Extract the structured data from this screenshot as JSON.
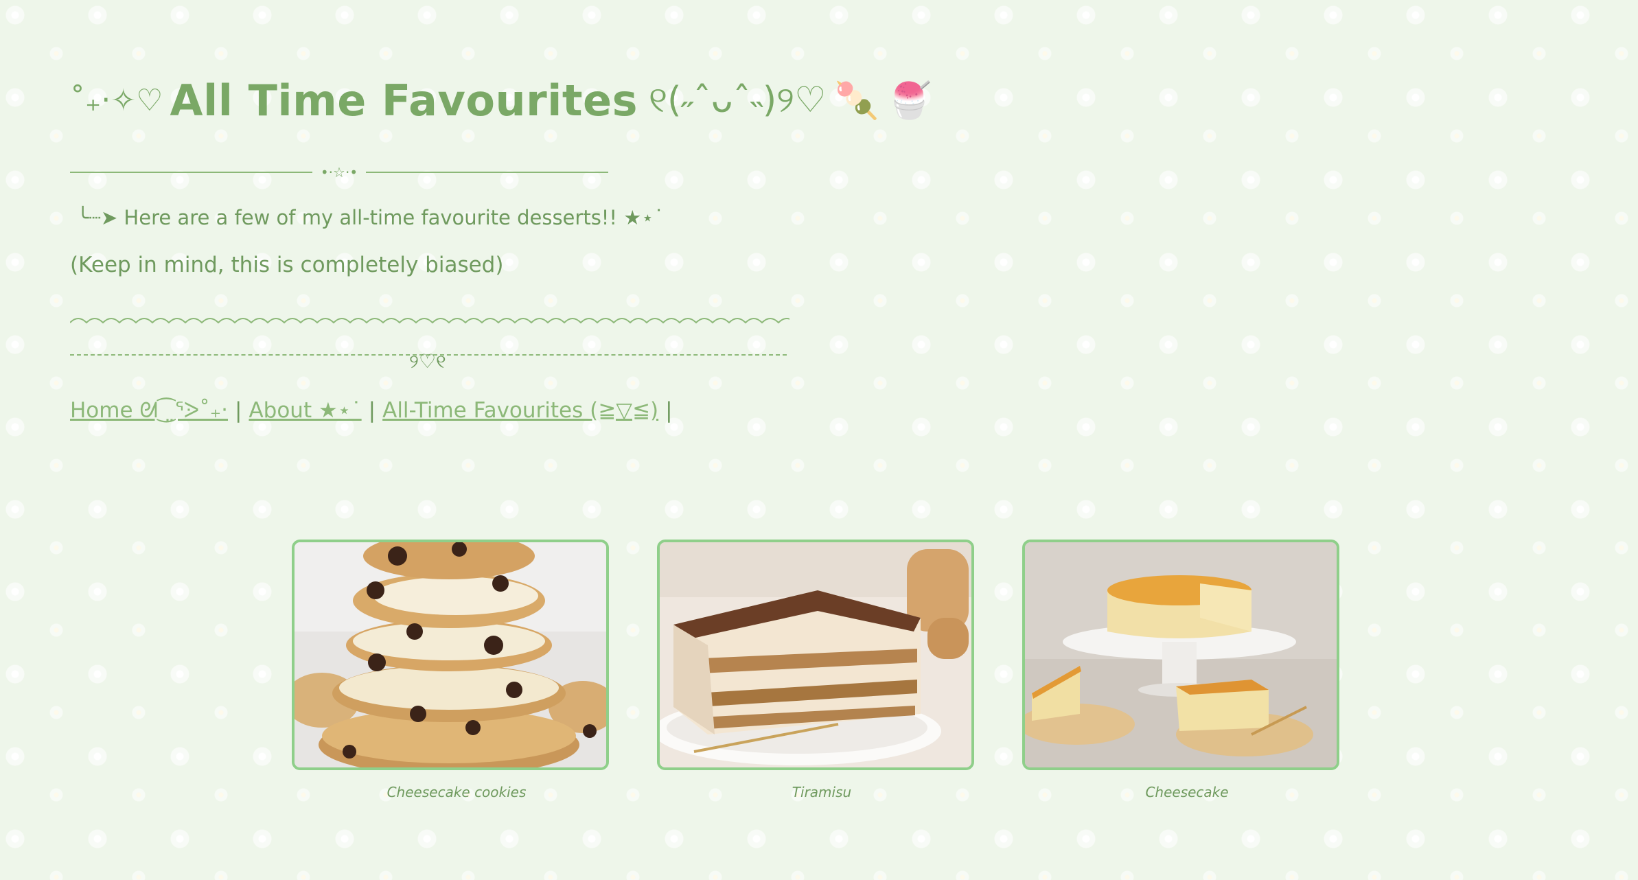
{
  "header": {
    "deco_left": "˚₊‧✧♡",
    "title": "All Time Favourites",
    "deco_right": "୧(˶ˆᴗˆ˵)୨♡",
    "emoji_1": "🍡",
    "emoji_2": "🍧"
  },
  "divider": {
    "center": "•·☆·•"
  },
  "intro": {
    "line1": "╰┈➤ Here are a few of my all-time favourite desserts!! ★⋆˙",
    "line2": "(Keep in mind, this is completely biased)"
  },
  "heart_divider": {
    "symbol": "୨♡୧"
  },
  "nav": {
    "home": "Home ᘛ⁐̤ᕐᐷ˚₊‧",
    "about": "About ★⋆˙",
    "favourites": "All-Time Favourites (≧▽≦)",
    "sep": "|"
  },
  "gallery": [
    {
      "caption": "Cheesecake cookies"
    },
    {
      "caption": "Tiramisu"
    },
    {
      "caption": "Cheesecake"
    }
  ],
  "colors": {
    "accent": "#7aa866",
    "frame_border": "#8fcf8a",
    "background": "#eef6ea"
  }
}
